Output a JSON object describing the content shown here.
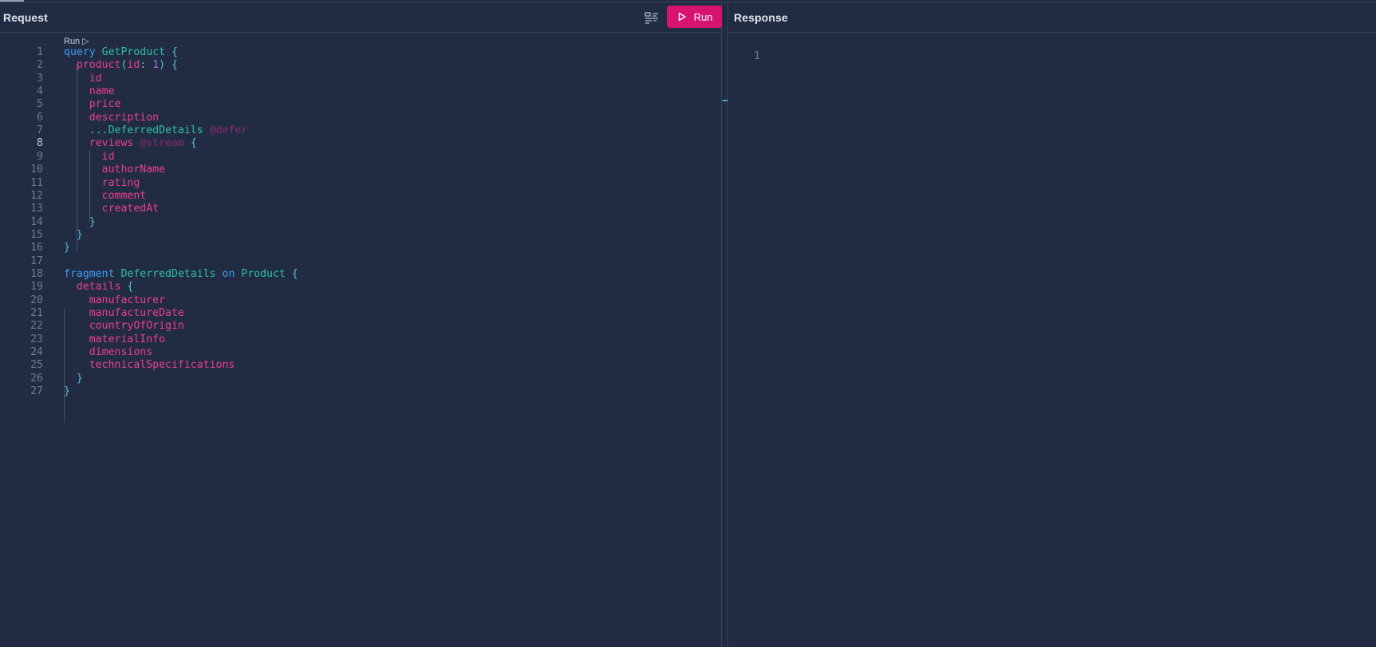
{
  "request": {
    "title": "Request",
    "run_label": "Run",
    "codelens": "Run ▷"
  },
  "response": {
    "title": "Response",
    "line_numbers": [
      "1"
    ]
  },
  "icons": {
    "prettify": "prettify-icon",
    "run": "play-icon"
  },
  "colors": {
    "background": "#212c43",
    "run_button": "#d6136f",
    "keyword": "#3c9ef6",
    "type": "#2fbea5",
    "field": "#ec3e91",
    "directive": "#8a2a6a",
    "number": "#a26cf0"
  },
  "code_lines": [
    [
      {
        "c": "k",
        "t": "query"
      },
      {
        "c": "",
        "t": " "
      },
      {
        "c": "t",
        "t": "GetProduct"
      },
      {
        "c": "",
        "t": " "
      },
      {
        "c": "p",
        "t": "{"
      }
    ],
    [
      {
        "c": "",
        "t": "  "
      },
      {
        "c": "f",
        "t": "product"
      },
      {
        "c": "p",
        "t": "("
      },
      {
        "c": "f",
        "t": "id"
      },
      {
        "c": "p",
        "t": ": "
      },
      {
        "c": "n",
        "t": "1"
      },
      {
        "c": "p",
        "t": ") {"
      }
    ],
    [
      {
        "c": "",
        "t": "    "
      },
      {
        "c": "f",
        "t": "id"
      }
    ],
    [
      {
        "c": "",
        "t": "    "
      },
      {
        "c": "f",
        "t": "name"
      }
    ],
    [
      {
        "c": "",
        "t": "    "
      },
      {
        "c": "f",
        "t": "price"
      }
    ],
    [
      {
        "c": "",
        "t": "    "
      },
      {
        "c": "f",
        "t": "description"
      }
    ],
    [
      {
        "c": "",
        "t": "    "
      },
      {
        "c": "s",
        "t": "..."
      },
      {
        "c": "t",
        "t": "DeferredDetails"
      },
      {
        "c": "",
        "t": " "
      },
      {
        "c": "d",
        "t": "@defer"
      }
    ],
    [
      {
        "c": "",
        "t": "    "
      },
      {
        "c": "f",
        "t": "reviews"
      },
      {
        "c": "",
        "t": " "
      },
      {
        "c": "d",
        "t": "@stream"
      },
      {
        "c": "",
        "t": " "
      },
      {
        "c": "p",
        "t": "{"
      }
    ],
    [
      {
        "c": "",
        "t": "      "
      },
      {
        "c": "f",
        "t": "id"
      }
    ],
    [
      {
        "c": "",
        "t": "      "
      },
      {
        "c": "f",
        "t": "authorName"
      }
    ],
    [
      {
        "c": "",
        "t": "      "
      },
      {
        "c": "f",
        "t": "rating"
      }
    ],
    [
      {
        "c": "",
        "t": "      "
      },
      {
        "c": "f",
        "t": "comment"
      }
    ],
    [
      {
        "c": "",
        "t": "      "
      },
      {
        "c": "f",
        "t": "createdAt"
      }
    ],
    [
      {
        "c": "",
        "t": "    "
      },
      {
        "c": "p",
        "t": "}"
      }
    ],
    [
      {
        "c": "",
        "t": "  "
      },
      {
        "c": "p",
        "t": "}"
      }
    ],
    [
      {
        "c": "p",
        "t": "}"
      }
    ],
    [],
    [
      {
        "c": "k",
        "t": "fragment"
      },
      {
        "c": "",
        "t": " "
      },
      {
        "c": "t",
        "t": "DeferredDetails"
      },
      {
        "c": "",
        "t": " "
      },
      {
        "c": "k",
        "t": "on"
      },
      {
        "c": "",
        "t": " "
      },
      {
        "c": "t",
        "t": "Product"
      },
      {
        "c": "",
        "t": " "
      },
      {
        "c": "p",
        "t": "{"
      }
    ],
    [
      {
        "c": "",
        "t": "  "
      },
      {
        "c": "f",
        "t": "details"
      },
      {
        "c": "",
        "t": " "
      },
      {
        "c": "p",
        "t": "{"
      }
    ],
    [
      {
        "c": "",
        "t": "    "
      },
      {
        "c": "f",
        "t": "manufacturer"
      }
    ],
    [
      {
        "c": "",
        "t": "    "
      },
      {
        "c": "f",
        "t": "manufactureDate"
      }
    ],
    [
      {
        "c": "",
        "t": "    "
      },
      {
        "c": "f",
        "t": "countryOfOrigin"
      }
    ],
    [
      {
        "c": "",
        "t": "    "
      },
      {
        "c": "f",
        "t": "materialInfo"
      }
    ],
    [
      {
        "c": "",
        "t": "    "
      },
      {
        "c": "f",
        "t": "dimensions"
      }
    ],
    [
      {
        "c": "",
        "t": "    "
      },
      {
        "c": "f",
        "t": "technicalSpecifications"
      }
    ],
    [
      {
        "c": "",
        "t": "  "
      },
      {
        "c": "p",
        "t": "}"
      }
    ],
    [
      {
        "c": "p",
        "t": "}"
      }
    ]
  ],
  "active_line": 8
}
